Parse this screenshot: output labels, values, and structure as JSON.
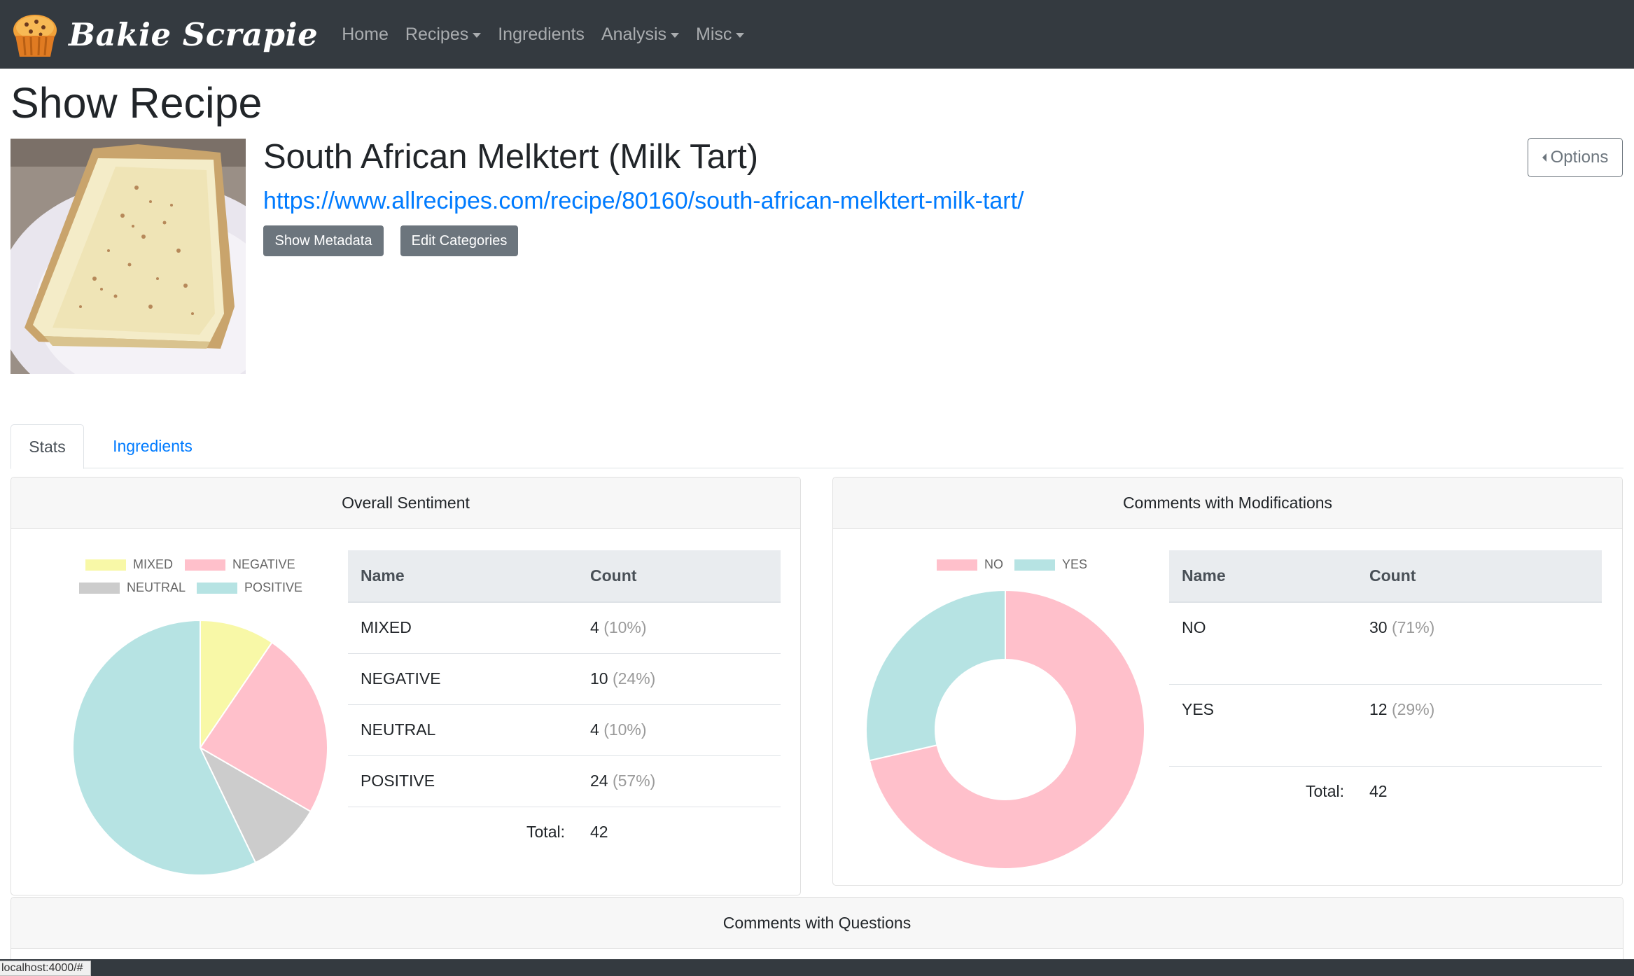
{
  "app": {
    "brand": "Bakie Scrapie",
    "nav": [
      {
        "label": "Home",
        "dropdown": false
      },
      {
        "label": "Recipes",
        "dropdown": true
      },
      {
        "label": "Ingredients",
        "dropdown": false
      },
      {
        "label": "Analysis",
        "dropdown": true
      },
      {
        "label": "Misc",
        "dropdown": true
      }
    ]
  },
  "page": {
    "title": "Show Recipe",
    "options_label": "Options"
  },
  "recipe": {
    "name": "South African Melktert (Milk Tart)",
    "url": "https://www.allrecipes.com/recipe/80160/south-african-melktert-milk-tart/",
    "show_metadata_label": "Show Metadata",
    "edit_categories_label": "Edit Categories"
  },
  "tabs": [
    {
      "label": "Stats",
      "active": true
    },
    {
      "label": "Ingredients",
      "active": false
    }
  ],
  "sentiment": {
    "title": "Overall Sentiment",
    "columns": [
      "Name",
      "Count"
    ],
    "rows": [
      {
        "name": "MIXED",
        "count": "4",
        "pct": "(10%)"
      },
      {
        "name": "NEGATIVE",
        "count": "10",
        "pct": "(24%)"
      },
      {
        "name": "NEUTRAL",
        "count": "4",
        "pct": "(10%)"
      },
      {
        "name": "POSITIVE",
        "count": "24",
        "pct": "(57%)"
      }
    ],
    "total_label": "Total:",
    "total_value": "42"
  },
  "modifications": {
    "title": "Comments with Modifications",
    "columns": [
      "Name",
      "Count"
    ],
    "rows": [
      {
        "name": "NO",
        "count": "30",
        "pct": "(71%)"
      },
      {
        "name": "YES",
        "count": "12",
        "pct": "(29%)"
      }
    ],
    "total_label": "Total:",
    "total_value": "42"
  },
  "questions": {
    "title": "Comments with Questions"
  },
  "status_bar": {
    "url": "localhost:4000/#"
  },
  "colors": {
    "navbar": "#343a40",
    "link": "#007bff",
    "mixed": "#f8f8a7",
    "negative": "#ffc0cb",
    "neutral": "#cccccc",
    "positive": "#b6e3e3",
    "no": "#ffc0cb",
    "yes": "#b6e3e3"
  },
  "chart_data": [
    {
      "type": "pie",
      "categories": [
        "MIXED",
        "NEGATIVE",
        "NEUTRAL",
        "POSITIVE"
      ],
      "values": [
        4,
        10,
        4,
        24
      ],
      "colors": [
        "#f8f8a7",
        "#ffc0cb",
        "#cccccc",
        "#b6e3e3"
      ],
      "legend": "top"
    },
    {
      "type": "doughnut",
      "categories": [
        "NO",
        "YES"
      ],
      "values": [
        30,
        12
      ],
      "colors": [
        "#ffc0cb",
        "#b6e3e3"
      ],
      "legend": "top"
    }
  ]
}
